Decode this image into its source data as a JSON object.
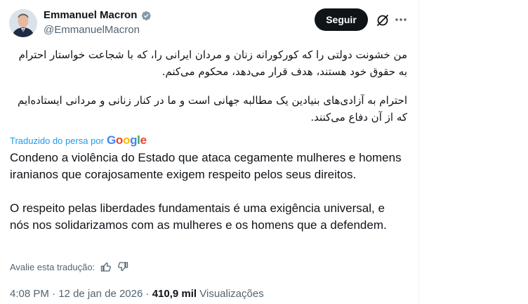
{
  "author": {
    "name": "Emmanuel Macron",
    "handle": "@EmmanuelMacron",
    "verified_color": "#829aab"
  },
  "actions": {
    "follow_label": "Seguir",
    "grok_icon": "grok-icon",
    "more_icon": "more-icon"
  },
  "post": {
    "original_paragraphs": [
      "من خشونت دولتی را که کورکورانه زنان و مردان ایرانی را، که با شجاعت خواستار احترام به حقوق خود هستند، هدف قرار می‌دهد، محکوم می‌کنم.",
      "احترام به آزادی‌های بنیادین یک مطالبه جهانی است و ما در کنار زنانی و مردانی ایستاده‌ایم که از آن دفاع می‌کنند."
    ],
    "translated_by_label": "Traduzido do persa por",
    "translator_brand": "Google",
    "translation_paragraphs": [
      "Condeno a violência do Estado que ataca cegamente mulheres e homens iranianos que corajosamente exigem respeito pelos seus direitos.",
      "O respeito pelas liberdades fundamentais é uma exigência universal, e nós nos solidarizamos com as mulheres e os homens que a defendem."
    ],
    "rate_label": "Avalie esta tradução:",
    "time": "4:08 PM",
    "separator": "·",
    "date": "12 de jan de 2026",
    "views_count": "410,9 mil",
    "views_label": "Visualizações"
  },
  "colors": {
    "accent": "#1d9bf0",
    "text_primary": "#0f1419",
    "text_secondary": "#536471",
    "button_bg": "#0f1419"
  }
}
